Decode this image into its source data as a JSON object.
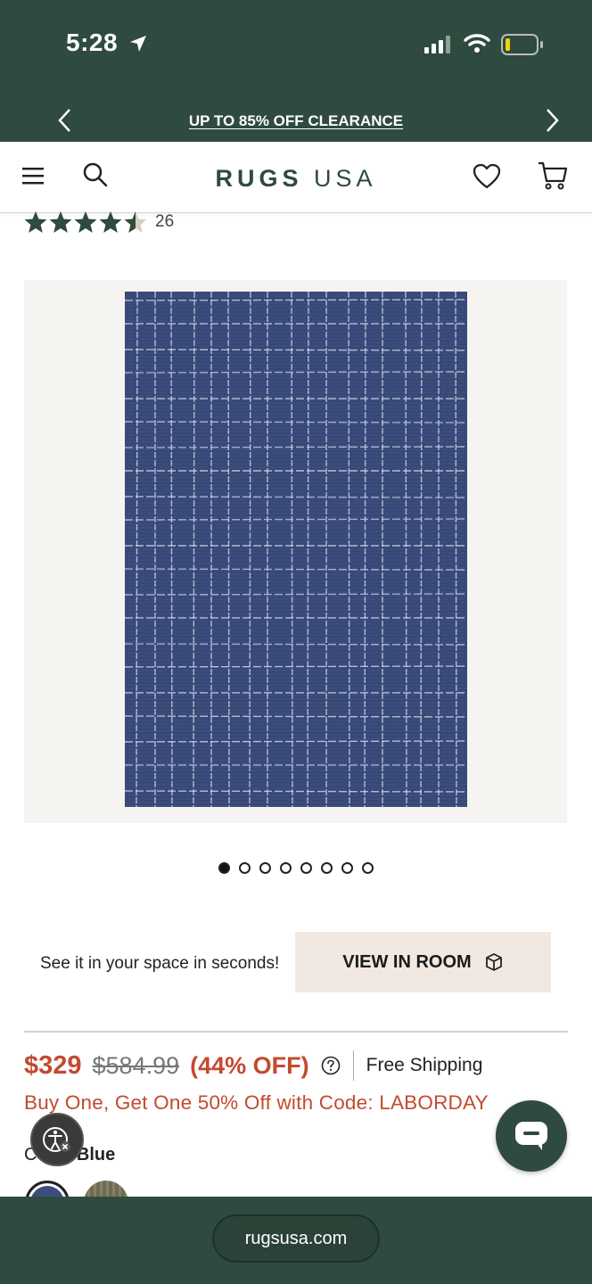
{
  "status_bar": {
    "time": "5:28",
    "icons": [
      "location-arrow-icon",
      "cellular-signal-icon",
      "wifi-icon",
      "battery-low-icon"
    ]
  },
  "promo_bar": {
    "text": "UP TO 85% OFF CLEARANCE",
    "prev_icon": "chevron-left-icon",
    "next_icon": "chevron-right-icon"
  },
  "header": {
    "logo_part1": "RUGS",
    "logo_part2": "USA",
    "brand_color": "#2f4a3f",
    "icons": [
      "hamburger-menu-icon",
      "search-icon",
      "heart-icon",
      "cart-icon"
    ]
  },
  "product": {
    "rating": 4.5,
    "review_count": "26",
    "image_count": 8,
    "active_image": 1,
    "room_prompt": "See it in your space in seconds!",
    "view_room_label": "VIEW IN ROOM",
    "price": "$329",
    "compare_price": "$584.99",
    "discount": "(44% OFF)",
    "shipping": "Free Shipping",
    "promo_code_text": "Buy One, Get One 50% Off with Code: LABORDAY",
    "color_label": "Color:",
    "color_value": "Blue",
    "sale_color": "#c34a2f"
  },
  "browser": {
    "url": "rugsusa.com"
  }
}
